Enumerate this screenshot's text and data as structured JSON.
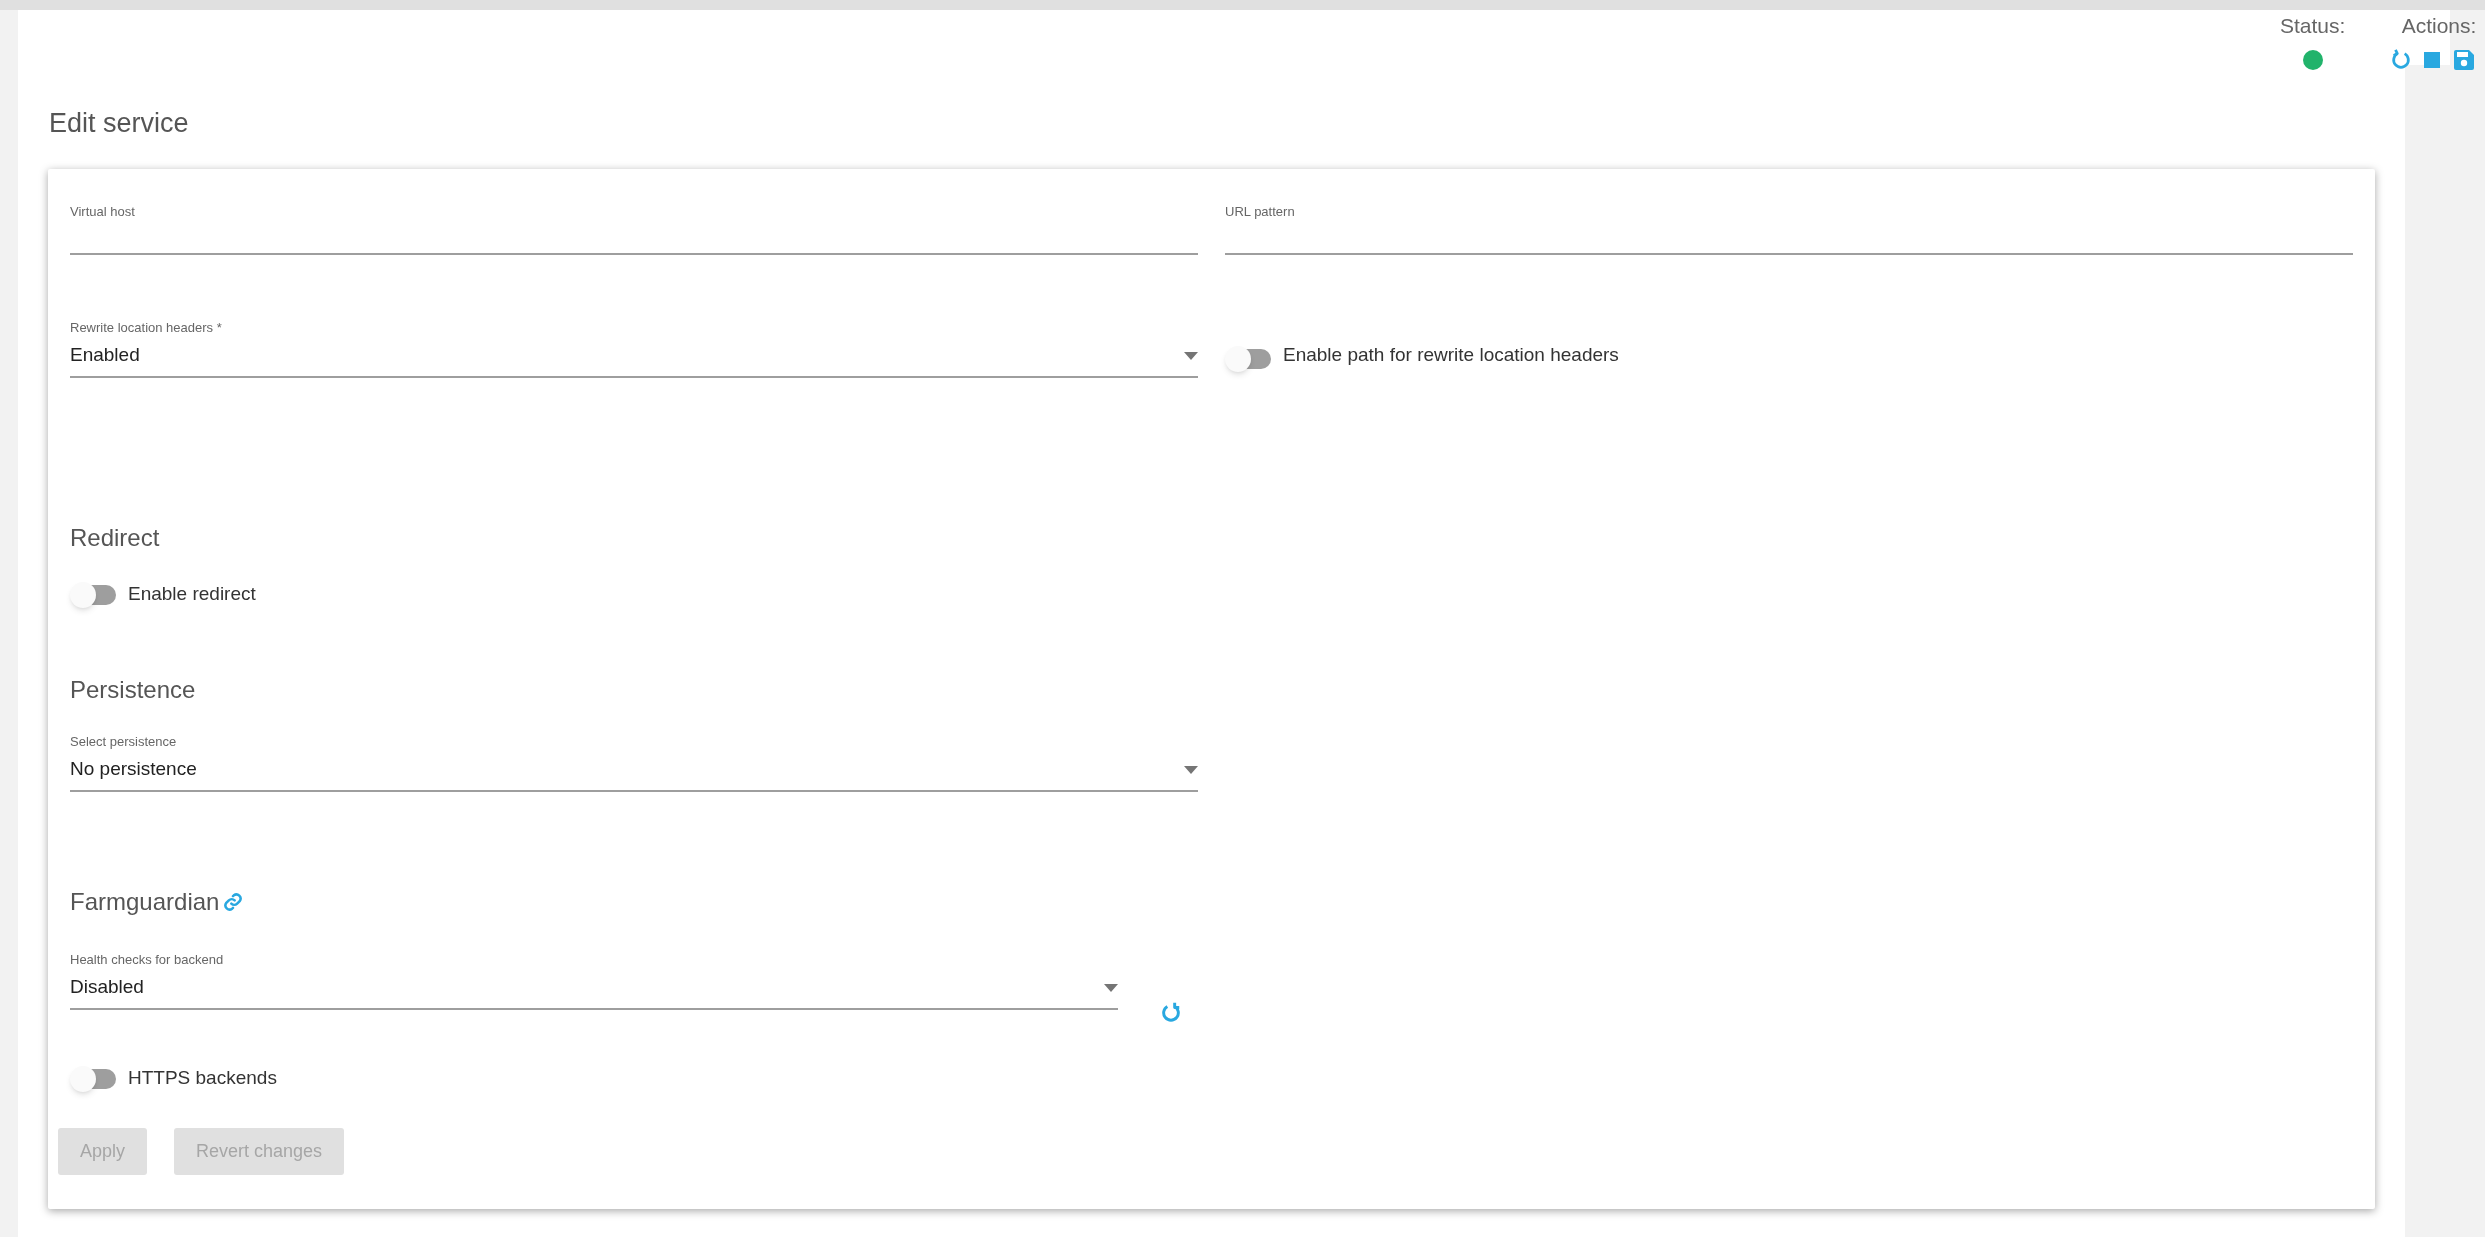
{
  "header": {
    "status_label": "Status:",
    "status_online": true,
    "actions_label": "Actions:"
  },
  "title": "Edit service",
  "fields": [
    {
      "label": "Virtual host"
    },
    {
      "label": "URL pattern"
    }
  ],
  "rewrite": {
    "label": "Rewrite location headers *",
    "value": "Enabled"
  },
  "rewrite_path_toggle": {
    "label": "Enable path for rewrite location headers",
    "on": false
  },
  "redirect": {
    "heading": "Redirect",
    "toggle": {
      "label": "Enable redirect",
      "on": false
    }
  },
  "persistence": {
    "heading": "Persistence",
    "label": "Select persistence",
    "value": "No persistence"
  },
  "farmguardian": {
    "heading": "Farmguardian",
    "label": "Health checks for backend",
    "value": "Disabled"
  },
  "https_toggle": {
    "label": "HTTPS backends",
    "on": false
  },
  "buttons": [
    {
      "label": "Apply",
      "disabled": true
    },
    {
      "label": "Revert changes",
      "disabled": true
    }
  ]
}
